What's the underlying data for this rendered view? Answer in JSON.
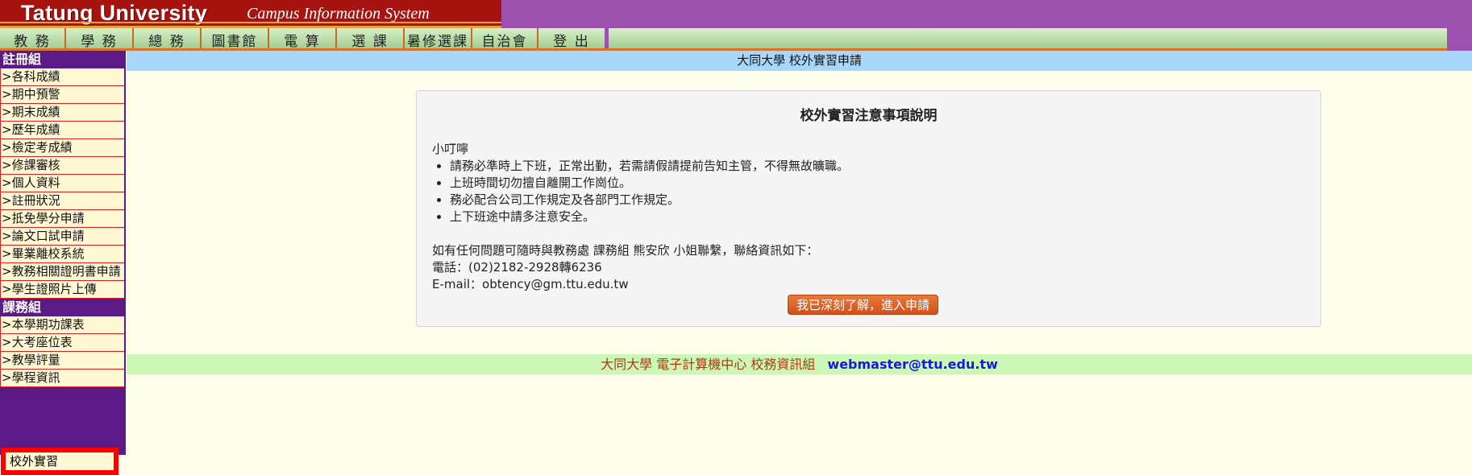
{
  "header": {
    "logo_name": "Tatung University",
    "logo_sub": "Campus Information System"
  },
  "menu": [
    {
      "label": "教 務",
      "w": 82
    },
    {
      "label": "學 務",
      "w": 84
    },
    {
      "label": "總 務",
      "w": 84
    },
    {
      "label": "圖書館",
      "w": 84
    },
    {
      "label": "電 算",
      "w": 84
    },
    {
      "label": "選 課",
      "w": 84
    },
    {
      "label": "暑修選課",
      "w": 84
    },
    {
      "label": "自治會",
      "w": 82
    },
    {
      "label": "登 出",
      "w": 82
    }
  ],
  "sidebar": {
    "section1": "註冊組",
    "items1": [
      ">各科成績",
      ">期中預警",
      ">期末成績",
      ">歷年成績",
      ">檢定考成績",
      ">修課審核",
      ">個人資料",
      ">註冊狀況",
      ">抵免學分申請",
      ">論文口試申請",
      ">畢業離校系統",
      ">教務相關證明書申請",
      ">學生證照片上傳"
    ],
    "section2": "課務組",
    "items2": [
      ">本學期功課表",
      ">大考座位表",
      ">教學評量",
      ">學程資訊"
    ],
    "highlighted": "校外實習"
  },
  "main": {
    "title": "大同大學 校外實習申請",
    "panel": {
      "heading": "校外實習注意事項說明",
      "reminder": "小叮嚀",
      "bullets": [
        "請務必準時上下班，正常出勤，若需請假請提前告知主管，不得無故曠職。",
        "上班時間切勿擅自離開工作崗位。",
        "務必配合公司工作規定及各部門工作規定。",
        "上下班途中請多注意安全。"
      ],
      "contact_line": "如有任何問題可隨時與教務處 課務組 熊安欣 小姐聯繫，聯絡資訊如下：",
      "phone": "電話：(02)2182-2928轉6236",
      "email": "E-mail：obtency@gm.ttu.edu.tw",
      "button": "我已深刻了解，進入申請"
    },
    "footer": {
      "org": "大同大學 電子計算機中心 校務資訊組",
      "mail": "webmaster@ttu.edu.tw"
    }
  }
}
